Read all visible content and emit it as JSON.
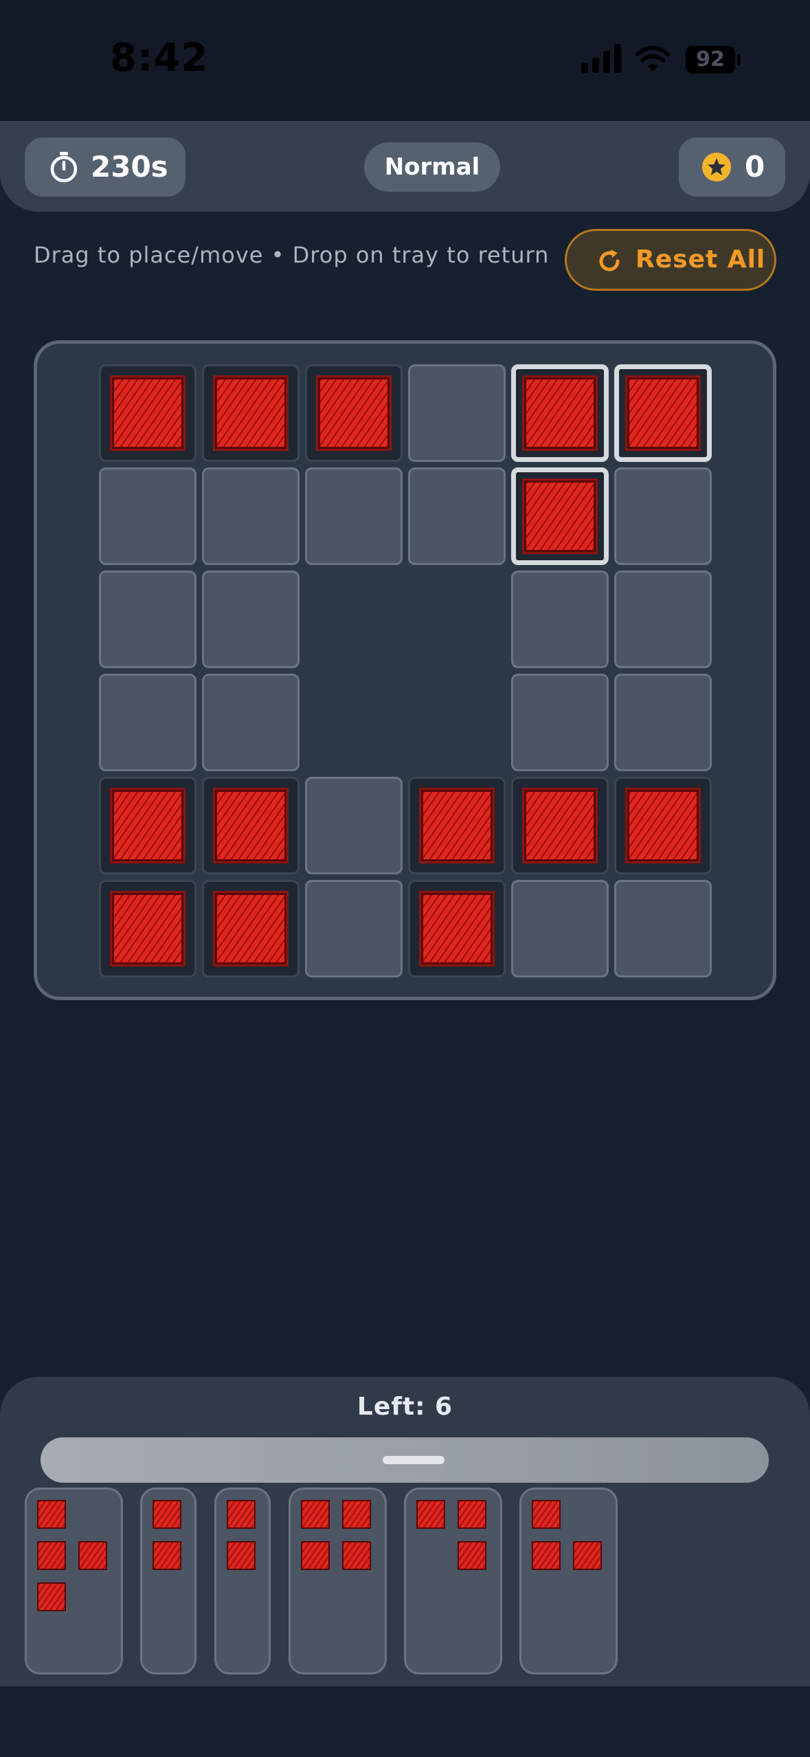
{
  "status_bar": {
    "time": "8:42",
    "battery": "92",
    "icons": [
      "signal-icon",
      "wifi-icon",
      "battery-icon"
    ]
  },
  "header": {
    "timer": {
      "icon": "stopwatch-icon",
      "value": "230s"
    },
    "mode": "Normal",
    "score": {
      "icon": "star-coin-icon",
      "value": "0"
    }
  },
  "instructions": "Drag to place/move • Drop on tray to return",
  "reset": {
    "label": "Reset All",
    "icon": "refresh-icon"
  },
  "board": {
    "rows": 6,
    "cols": 6,
    "cells": [
      [
        "filled",
        "filled",
        "filled",
        "empty",
        "selected",
        "selected"
      ],
      [
        "empty",
        "empty",
        "empty",
        "empty",
        "selected",
        "empty"
      ],
      [
        "empty",
        "empty",
        "void",
        "void",
        "empty",
        "empty"
      ],
      [
        "empty",
        "empty",
        "void",
        "void",
        "empty",
        "empty"
      ],
      [
        "filled",
        "filled",
        "empty",
        "filled",
        "filled",
        "filled"
      ],
      [
        "filled",
        "filled",
        "empty",
        "filled",
        "empty",
        "empty"
      ]
    ]
  },
  "tray": {
    "title": "Left: 6",
    "pieces": [
      {
        "rows": 3,
        "cols": 2,
        "cells": [
          [
            1,
            0
          ],
          [
            1,
            1
          ],
          [
            1,
            0
          ]
        ]
      },
      {
        "rows": 2,
        "cols": 1,
        "cells": [
          [
            1
          ],
          [
            1
          ]
        ]
      },
      {
        "rows": 2,
        "cols": 1,
        "cells": [
          [
            1
          ],
          [
            1
          ]
        ]
      },
      {
        "rows": 2,
        "cols": 2,
        "cells": [
          [
            1,
            1
          ],
          [
            1,
            1
          ]
        ]
      },
      {
        "rows": 2,
        "cols": 2,
        "cells": [
          [
            1,
            1
          ],
          [
            0,
            1
          ]
        ]
      },
      {
        "rows": 2,
        "cols": 2,
        "cells": [
          [
            1,
            0
          ],
          [
            1,
            1
          ]
        ]
      }
    ]
  },
  "colors": {
    "background": "#16202f",
    "block": "#e0261f",
    "accent": "#f29a26",
    "empty_cell": "#4b5563",
    "selected_border": "#d6d9de"
  }
}
